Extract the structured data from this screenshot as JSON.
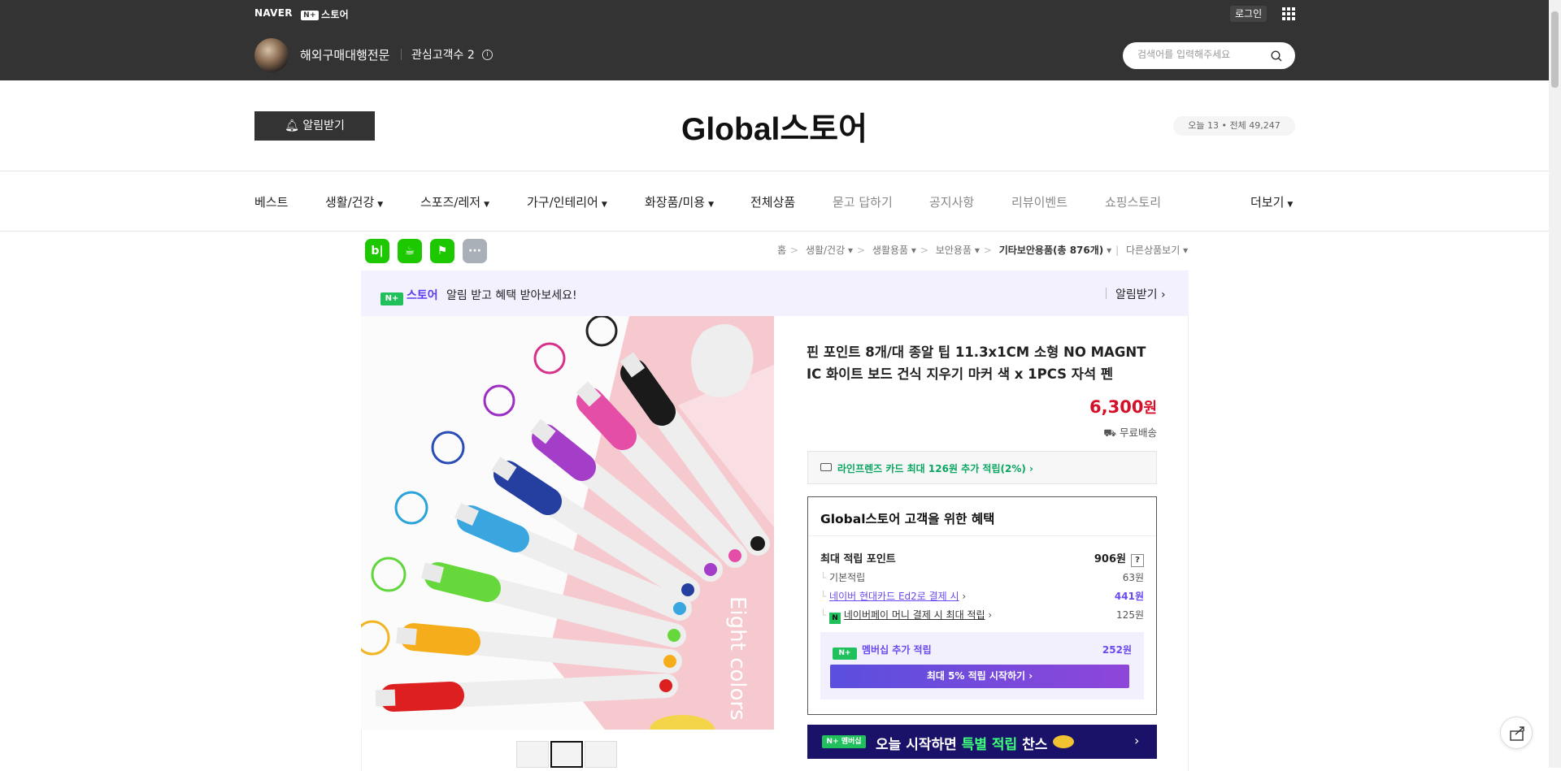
{
  "top_bar": {
    "naver_logo": "NAVER",
    "nplus_badge": "N+",
    "store_label": "스토어",
    "login_label": "로그인",
    "store_name": "해외구매대행전문",
    "interest_customers": "관심고객수 2",
    "search_placeholder": "검색어를 입력해주세요"
  },
  "header": {
    "alarm_button": "알림받기",
    "store_title": "Global스토어",
    "visitors": "오늘 13 • 전체 49,247"
  },
  "nav": {
    "items": [
      {
        "label": "베스트",
        "dropdown": false
      },
      {
        "label": "생활/건강",
        "dropdown": true
      },
      {
        "label": "스포즈/레저",
        "dropdown": true
      },
      {
        "label": "가구/인테리어",
        "dropdown": true
      },
      {
        "label": "화장품/미용",
        "dropdown": true
      },
      {
        "label": "전체상품",
        "dropdown": false
      },
      {
        "label": "묻고 답하기",
        "dropdown": false
      },
      {
        "label": "공지사항",
        "dropdown": false
      },
      {
        "label": "리뷰이벤트",
        "dropdown": false
      },
      {
        "label": "쇼핑스토리",
        "dropdown": false
      }
    ],
    "more": "더보기"
  },
  "share_icons": [
    "blog-icon",
    "cafe-icon",
    "bookmark-icon",
    "more-icon"
  ],
  "breadcrumb": {
    "items": [
      "홈",
      "생활/건강",
      "생활용품",
      "보안용품"
    ],
    "current": "기타보안용품(총 876개)",
    "other": "다른상품보기"
  },
  "nplus_banner": {
    "logo_text": "스토어",
    "message": "알림 받고 혜택 받아보세요!",
    "action": "알림받기"
  },
  "product": {
    "title": "핀 포인트 8개/대 종알 팁 11.3x1CM 소형 NO MAGNT IC 화이트 보드 건식 지우기 마커 색 x 1PCS 자석 펜",
    "price": "6,300",
    "price_unit": "원",
    "shipping": "무료배송",
    "image_caption": "Eight colors",
    "card_promo": "라인프렌즈 카드 최대 126원 추가 적립(2%)",
    "thumbnails": 3
  },
  "benefits": {
    "heading": "Global스토어 고객을 위한 혜택",
    "max_points_label": "최대 적립 포인트",
    "max_points_value": "906원",
    "rows": [
      {
        "label": "기본적립",
        "value": "63원"
      },
      {
        "label": "네이버 현대카드 Ed2로 결제 시",
        "value": "441원"
      },
      {
        "label": "네이버페이 머니 결제 시 최대 적립",
        "value": "125원"
      }
    ],
    "membership_label": "멤버십 추가 적립",
    "membership_value": "252원",
    "membership_button": "최대 5% 적립 시작하기"
  },
  "bottom_banner": {
    "badge": "멤버십",
    "text_a": "오늘 시작하면 ",
    "text_b": "특별 적립",
    "text_c": " 찬스"
  },
  "colors": {
    "top_bg": "#333333",
    "price_red": "#d60f29",
    "naver_green": "#20c05c",
    "nplus_purple": "#6b49ed"
  }
}
